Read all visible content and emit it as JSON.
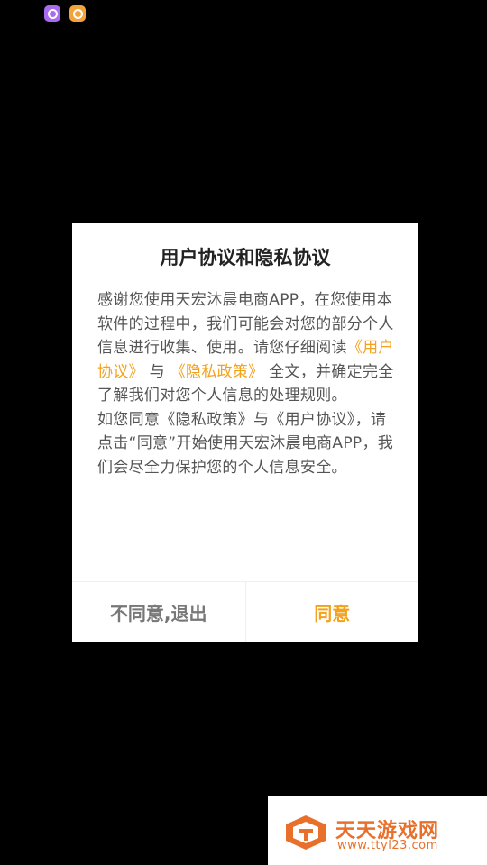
{
  "status_bar": {
    "icons": [
      "purple-app-icon",
      "orange-app-icon"
    ]
  },
  "dialog": {
    "title": "用户协议和隐私协议",
    "body": {
      "p1_before_links": "感谢您使用天宏沐晨电商APP，在您使用本软件的过程中，我们可能会对您的部分个人信息进行收集、使用。请您仔细阅读",
      "link_user_agreement": "《用户协议》",
      "and_text": " 与 ",
      "link_privacy_policy": "《隐私政策》",
      "p1_after_links": " 全文，并确定完全了解我们对您个人信息的处理规则。",
      "p2": "如您同意《隐私政策》与《用户协议》，请点击“同意”开始使用天宏沐晨电商APP，我们会尽全力保护您的个人信息安全。"
    },
    "buttons": {
      "disagree": "不同意,退出",
      "agree": "同意"
    }
  },
  "watermark": {
    "title": "天天游戏网",
    "url": "www.ttyl23.com"
  },
  "colors": {
    "accent": "#f4a21d",
    "background": "#000000",
    "dialog_background": "#ffffff",
    "watermark": "#e8702a"
  }
}
